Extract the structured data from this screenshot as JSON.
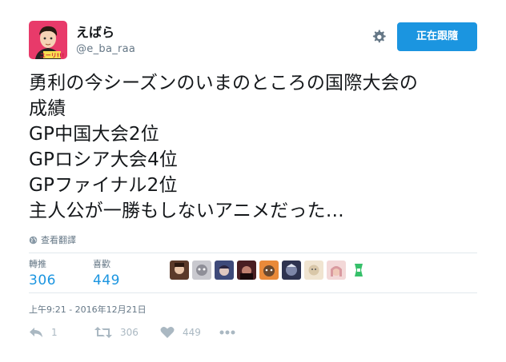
{
  "user": {
    "display_name": "えばら",
    "screen_name": "@e_ba_raa",
    "avatar_badge": "ユーリ!!!"
  },
  "follow_button": {
    "label": "正在跟隨"
  },
  "tweet": {
    "text": "勇利の今シーズンのいまのところの国際大会の\n成績\nGP中国大会2位\nGPロシア大会4位\nGPファイナル2位\n主人公が一勝もしないアニメだった…"
  },
  "translate": {
    "label": "查看翻譯"
  },
  "stats": {
    "retweets_label": "轉推",
    "retweets_value": "306",
    "likes_label": "喜歡",
    "likes_value": "449"
  },
  "timestamp": "上午9:21 - 2016年12月21日",
  "actions": {
    "reply_count": "1",
    "retweet_count": "306",
    "like_count": "449"
  },
  "colors": {
    "accent": "#1b95e0",
    "muted": "#657786",
    "icon": "#aab8c2",
    "divider": "#e1e8ed"
  }
}
